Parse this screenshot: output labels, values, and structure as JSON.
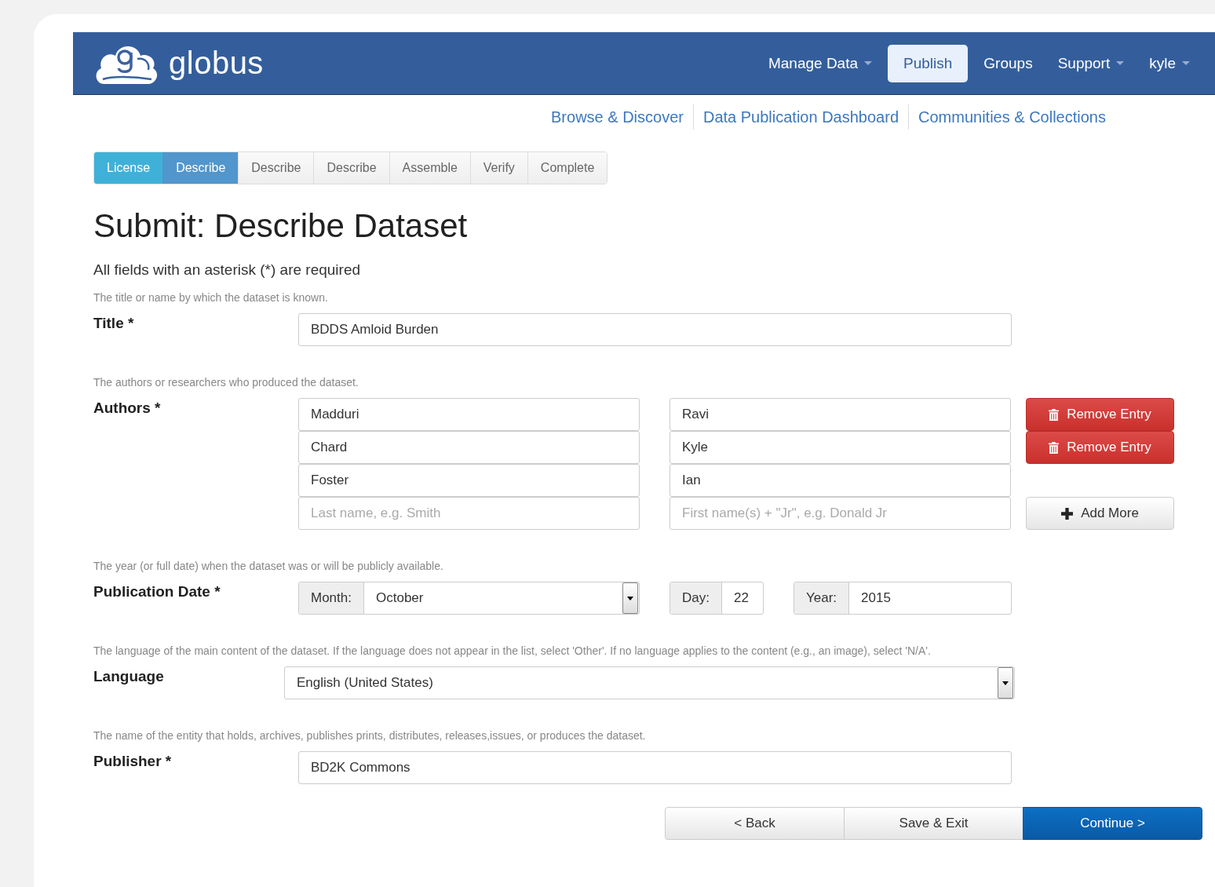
{
  "brand": {
    "name": "globus"
  },
  "nav": [
    {
      "label": "Manage Data",
      "dropdown": true,
      "selected": false
    },
    {
      "label": "Publish",
      "dropdown": false,
      "selected": true
    },
    {
      "label": "Groups",
      "dropdown": false,
      "selected": false
    },
    {
      "label": "Support",
      "dropdown": true,
      "selected": false
    },
    {
      "label": "kyle",
      "dropdown": true,
      "selected": false
    }
  ],
  "sublinks": [
    "Browse & Discover",
    "Data Publication Dashboard",
    "Communities & Collections"
  ],
  "steps": [
    {
      "label": "License",
      "completed": true,
      "selected": false
    },
    {
      "label": "Describe",
      "completed": false,
      "selected": true
    },
    {
      "label": "Describe",
      "completed": false,
      "selected": false
    },
    {
      "label": "Describe",
      "completed": false,
      "selected": false
    },
    {
      "label": "Assemble",
      "completed": false,
      "selected": false
    },
    {
      "label": "Verify",
      "completed": false,
      "selected": false
    },
    {
      "label": "Complete",
      "completed": false,
      "selected": false
    }
  ],
  "heading": "Submit: Describe Dataset",
  "required_note": "All fields with an asterisk (*) are required",
  "fields": [
    {
      "kind": "text",
      "hint": "The title or name by which the dataset is known.",
      "label": "Title *",
      "value": "BDDS Amloid Burden"
    },
    {
      "kind": "authors",
      "hint": "The authors or researchers who produced the dataset.",
      "label": "Authors *",
      "rows": [
        {
          "last": {
            "value": "Madduri"
          },
          "first": {
            "value": "Ravi"
          },
          "button": {
            "kind": "remove",
            "label": "Remove Entry"
          }
        },
        {
          "last": {
            "value": "Chard"
          },
          "first": {
            "value": "Kyle"
          },
          "button": {
            "kind": "remove",
            "label": "Remove Entry"
          }
        },
        {
          "last": {
            "value": "Foster"
          },
          "first": {
            "value": "Ian"
          }
        },
        {
          "last": {
            "placeholder": "Last name, e.g. Smith"
          },
          "first": {
            "placeholder": "First name(s) + \"Jr\", e.g. Donald Jr"
          },
          "button": {
            "kind": "add",
            "label": "Add More"
          }
        }
      ]
    },
    {
      "kind": "date",
      "hint": "The year (or full date) when the dataset was or will be publicly available.",
      "label": "Publication Date *",
      "month_label": "Month:",
      "month": "October",
      "day_label": "Day:",
      "day": "22",
      "year_label": "Year:",
      "year": "2015"
    },
    {
      "kind": "select",
      "hint": "The language of the main content of the dataset. If the language does not appear in the list, select 'Other'. If no language applies to the content (e.g., an image), select 'N/A'.",
      "label": "Language",
      "value": "English (United States)"
    },
    {
      "kind": "text",
      "hint": "The name of the entity that holds, archives, publishes prints, distributes, releases,issues, or produces the dataset.",
      "label": "Publisher *",
      "value": "BD2K Commons"
    }
  ],
  "footer_buttons": [
    {
      "label": "< Back",
      "kind": "default"
    },
    {
      "label": "Save & Exit",
      "kind": "default"
    },
    {
      "label": "Continue >",
      "kind": "primary"
    }
  ]
}
